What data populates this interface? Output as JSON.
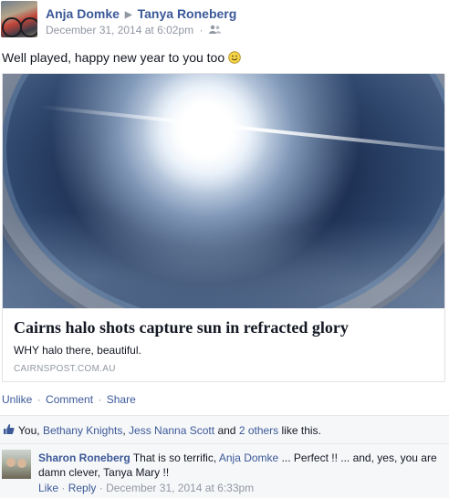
{
  "post": {
    "author": "Anja Domke",
    "target": "Tanya Roneberg",
    "timestamp": "December 31, 2014 at 6:02pm",
    "meta_separator": "·",
    "audience_icon": "friends-icon",
    "message": "Well played, happy new year to you too",
    "emoji": "smiley-icon"
  },
  "link_card": {
    "title": "Cairns halo shots capture sun in refracted glory",
    "description": "WHY halo there, beautiful.",
    "source": "CAIRNSPOST.COM.AU"
  },
  "actions": {
    "unlike": "Unlike",
    "comment": "Comment",
    "share": "Share",
    "separator": "·"
  },
  "likes": {
    "you": "You",
    "sep1": ",",
    "person1": "Bethany Knights",
    "sep2": ",",
    "person2": "Jess Nanna Scott",
    "and": "and",
    "others": "2 others",
    "suffix": "like this."
  },
  "comment": {
    "author": "Sharon Roneberg",
    "text_before": "That is so terrific,",
    "mention": "Anja Domke",
    "text_after": "... Perfect !! ... and, yes, you are damn clever, Tanya Mary !!",
    "like": "Like",
    "reply": "Reply",
    "separator": "·",
    "timestamp": "December 31, 2014 at 6:33pm"
  },
  "colors": {
    "link": "#3b5998",
    "muted": "#9197a3",
    "text": "#141823",
    "ufi_background": "#f6f7f9"
  }
}
